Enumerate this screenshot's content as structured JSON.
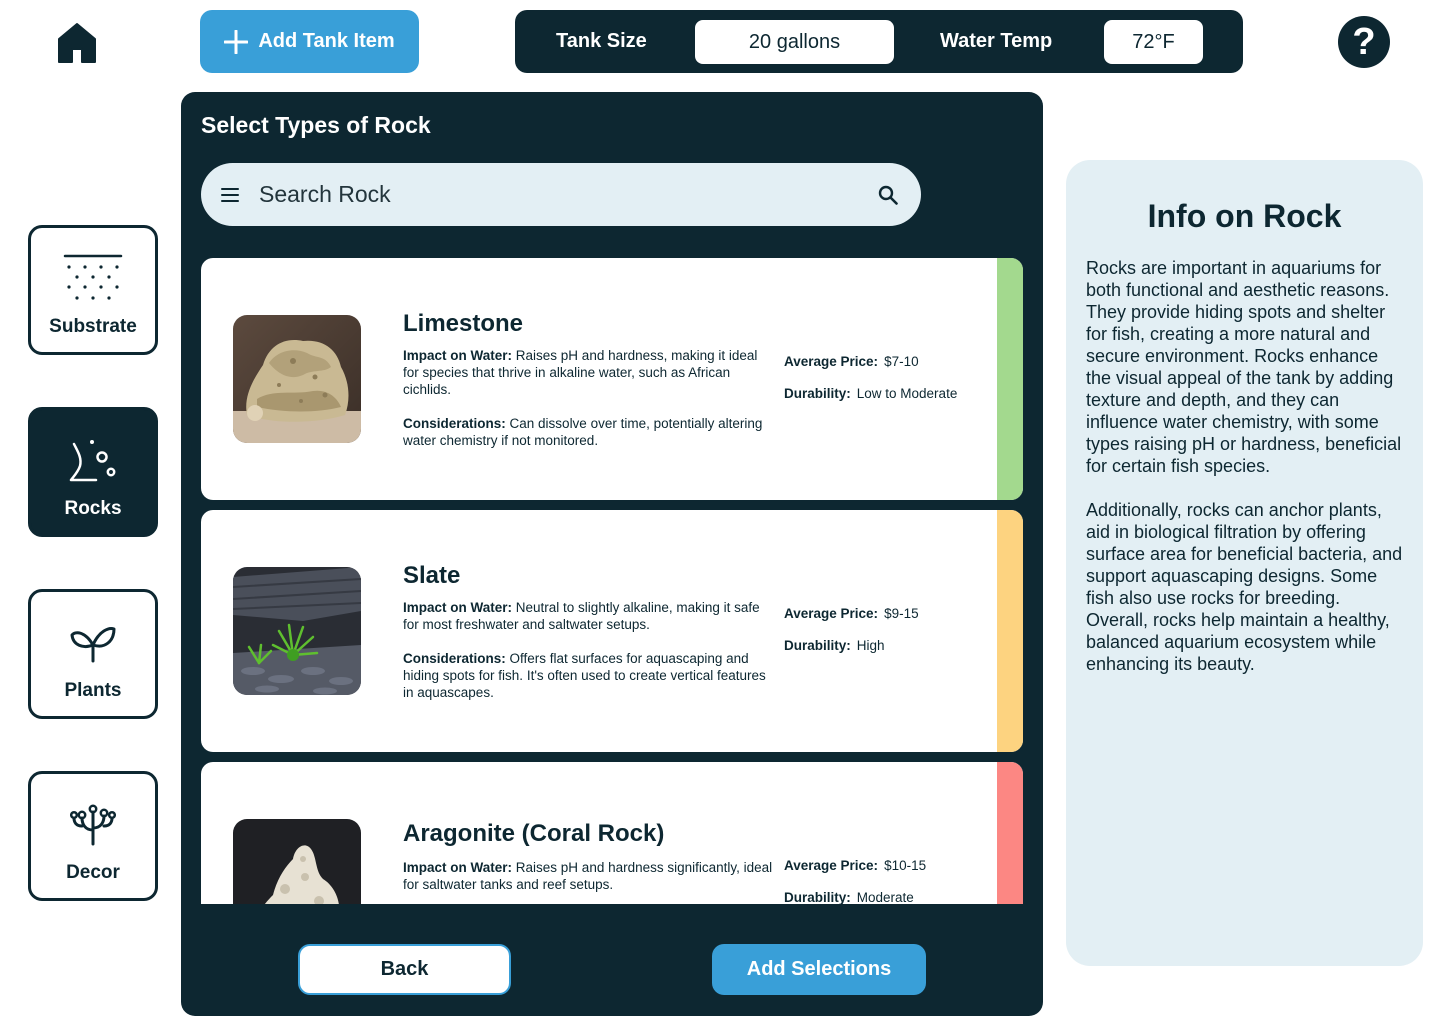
{
  "header": {
    "add_tank_item_label": "Add Tank Item",
    "tank_size_label": "Tank Size",
    "tank_size_value": "20 gallons",
    "water_temp_label": "Water Temp",
    "water_temp_value": "72°F",
    "help_label": "?"
  },
  "sidebar": {
    "items": [
      {
        "label": "Substrate",
        "icon": "substrate-icon",
        "active": false
      },
      {
        "label": "Rocks",
        "icon": "rocks-icon",
        "active": true
      },
      {
        "label": "Plants",
        "icon": "plant-icon",
        "active": false
      },
      {
        "label": "Decor",
        "icon": "decor-icon",
        "active": false
      }
    ]
  },
  "panel": {
    "title": "Select Types of Rock",
    "search_placeholder": "Search Rock",
    "impact_label": "Impact on Water:",
    "considerations_label": "Considerations:",
    "price_label": "Average Price:",
    "durability_label": "Durability:",
    "items": [
      {
        "name": "Limestone",
        "impact": "Raises pH and hardness, making it ideal for species that thrive in alkaline water, such as African cichlids.",
        "considerations": "Can dissolve over time, potentially altering water chemistry if not monitored.",
        "price": "$7-10",
        "durability": "Low to Moderate",
        "color": "#a3d98e"
      },
      {
        "name": "Slate",
        "impact": "Neutral to slightly alkaline, making it safe for most freshwater and saltwater setups.",
        "considerations": "Offers flat surfaces for aquascaping and hiding spots for fish. It's often used to create vertical features in aquascapes.",
        "price": "$9-15",
        "durability": "High",
        "color": "#fdd380"
      },
      {
        "name": "Aragonite (Coral Rock)",
        "impact": "Raises pH and hardness significantly, ideal for saltwater tanks and reef setups.",
        "considerations": "",
        "price": "$10-15",
        "durability": "Moderate",
        "color": "#fc8783"
      }
    ],
    "back_label": "Back",
    "add_selections_label": "Add Selections"
  },
  "info": {
    "title": "Info on Rock",
    "paragraphs": [
      "Rocks are important in aquariums for both functional and aesthetic reasons. They provide hiding spots and shelter for fish, creating a more natural and secure environment. Rocks enhance the visual appeal of the tank by adding texture and depth, and they can influence water chemistry, with some types raising pH or hardness, beneficial for certain fish species.",
      "Additionally, rocks can anchor plants, aid in biological filtration by offering surface area for beneficial bacteria, and support aquascaping designs. Some fish also use rocks for breeding. Overall, rocks help maintain a healthy, balanced aquarium ecosystem while enhancing its beauty."
    ]
  }
}
